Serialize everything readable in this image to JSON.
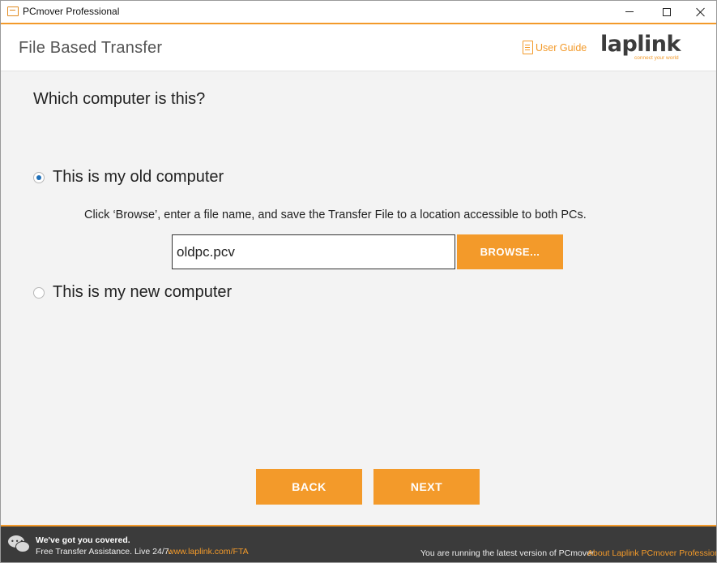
{
  "window": {
    "title": "PCmover Professional",
    "app_icon": "pcmover-app-icon"
  },
  "header": {
    "title": "File Based Transfer",
    "user_guide_label": "User Guide",
    "logo_text": "laplink",
    "logo_tagline": "connect your world"
  },
  "main": {
    "question": "Which computer is this?",
    "options": [
      {
        "label": "This is my old computer",
        "selected": true
      },
      {
        "label": "This is my new computer",
        "selected": false
      }
    ],
    "instructions": "Click ‘Browse’, enter a file name, and save the Transfer File to a location accessible to both PCs.",
    "file_name_value": "oldpc.pcv",
    "browse_label": "BROWSE..."
  },
  "nav": {
    "back_label": "BACK",
    "next_label": "NEXT"
  },
  "footer": {
    "covered_text": "We've got you covered.",
    "assist_text": "Free Transfer Assistance. Live 24/7.",
    "fta_link": "www.laplink.com/FTA",
    "latest_text": "You are running the latest version of PCmover.",
    "about_link": "About Laplink PCmover Professional"
  },
  "colors": {
    "accent": "#f39a2a",
    "radio_selected": "#1e6fb8",
    "footer_bg": "#3b3b3b"
  }
}
